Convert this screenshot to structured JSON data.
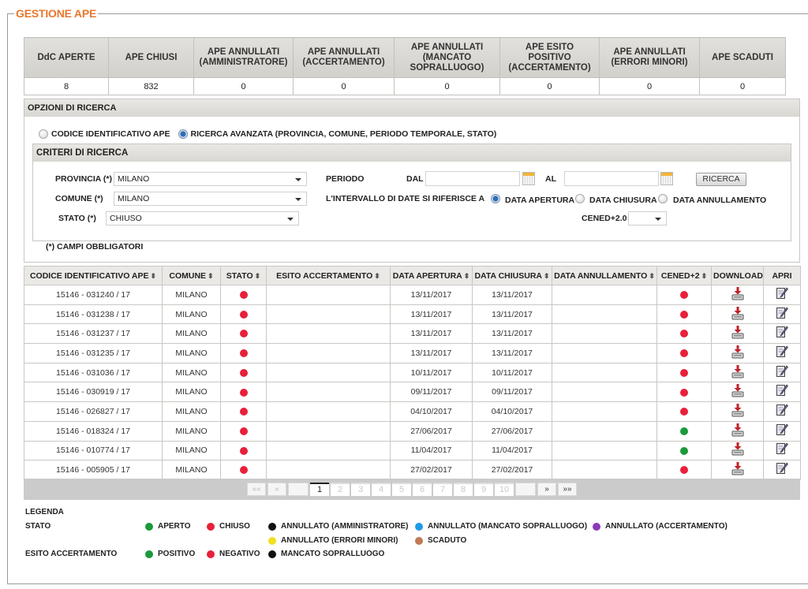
{
  "title": "GESTIONE APE",
  "summary": {
    "headers": [
      "DdC APERTE",
      "APE CHIUSI",
      "APE ANNULLATI (AMMINISTRATORE)",
      "APE ANNULLATI (ACCERTAMENTO)",
      "APE ANNULLATI (MANCATO SOPRALLUOGO)",
      "APE ESITO POSITIVO (ACCERTAMENTO)",
      "APE ANNULLATI (ERRORI MINORI)",
      "APE SCADUTI"
    ],
    "values": [
      "8",
      "832",
      "0",
      "0",
      "0",
      "0",
      "0",
      "0"
    ]
  },
  "search_options": {
    "title": "OPZIONI DI RICERCA",
    "mode_code_label": "CODICE IDENTIFICATIVO APE",
    "mode_advanced_label": "RICERCA AVANZATA (PROVINCIA, COMUNE, PERIODO TEMPORALE, STATO)",
    "selected_mode": "advanced",
    "criteria": {
      "title": "CRITERI DI RICERCA",
      "provincia_label": "PROVINCIA (*)",
      "provincia_value": "MILANO",
      "comune_label": "COMUNE (*)",
      "comune_value": "MILANO",
      "stato_label": "STATO (*)",
      "stato_value": "CHIUSO",
      "periodo_label": "PERIODO",
      "dal_label": "DAL",
      "dal_value": "",
      "al_label": "AL",
      "al_value": "",
      "search_button": "RICERCA",
      "interval_label": "L'INTERVALLO DI DATE SI RIFERISCE A",
      "interval_options": [
        "DATA APERTURA",
        "DATA CHIUSURA",
        "DATA ANNULLAMENTO"
      ],
      "interval_selected": "DATA APERTURA",
      "cened_label": "CENED+2.0",
      "cened_value": ""
    },
    "required_note": "(*) CAMPI OBBLIGATORI"
  },
  "results": {
    "columns": [
      "CODICE IDENTIFICATIVO APE",
      "COMUNE",
      "STATO",
      "ESITO ACCERTAMENTO",
      "DATA APERTURA",
      "DATA CHIUSURA",
      "DATA ANNULLAMENTO",
      "CENED+2",
      "DOWNLOAD",
      "APRI"
    ],
    "rows": [
      {
        "codice": "15146 - 031240 / 17",
        "comune": "MILANO",
        "stato": "CHIUSO",
        "esito": "",
        "apertura": "13/11/2017",
        "chiusura": "13/11/2017",
        "annullamento": "",
        "cened": "red"
      },
      {
        "codice": "15146 - 031238 / 17",
        "comune": "MILANO",
        "stato": "CHIUSO",
        "esito": "",
        "apertura": "13/11/2017",
        "chiusura": "13/11/2017",
        "annullamento": "",
        "cened": "red"
      },
      {
        "codice": "15146 - 031237 / 17",
        "comune": "MILANO",
        "stato": "CHIUSO",
        "esito": "",
        "apertura": "13/11/2017",
        "chiusura": "13/11/2017",
        "annullamento": "",
        "cened": "red"
      },
      {
        "codice": "15146 - 031235 / 17",
        "comune": "MILANO",
        "stato": "CHIUSO",
        "esito": "",
        "apertura": "13/11/2017",
        "chiusura": "13/11/2017",
        "annullamento": "",
        "cened": "red"
      },
      {
        "codice": "15146 - 031036 / 17",
        "comune": "MILANO",
        "stato": "CHIUSO",
        "esito": "",
        "apertura": "10/11/2017",
        "chiusura": "10/11/2017",
        "annullamento": "",
        "cened": "red"
      },
      {
        "codice": "15146 - 030919 / 17",
        "comune": "MILANO",
        "stato": "CHIUSO",
        "esito": "",
        "apertura": "09/11/2017",
        "chiusura": "09/11/2017",
        "annullamento": "",
        "cened": "red"
      },
      {
        "codice": "15146 - 026827 / 17",
        "comune": "MILANO",
        "stato": "CHIUSO",
        "esito": "",
        "apertura": "04/10/2017",
        "chiusura": "04/10/2017",
        "annullamento": "",
        "cened": "red"
      },
      {
        "codice": "15146 - 018324 / 17",
        "comune": "MILANO",
        "stato": "CHIUSO",
        "esito": "",
        "apertura": "27/06/2017",
        "chiusura": "27/06/2017",
        "annullamento": "",
        "cened": "green"
      },
      {
        "codice": "15146 - 010774 / 17",
        "comune": "MILANO",
        "stato": "CHIUSO",
        "esito": "",
        "apertura": "11/04/2017",
        "chiusura": "11/04/2017",
        "annullamento": "",
        "cened": "green"
      },
      {
        "codice": "15146 - 005905 / 17",
        "comune": "MILANO",
        "stato": "CHIUSO",
        "esito": "",
        "apertura": "27/02/2017",
        "chiusura": "27/02/2017",
        "annullamento": "",
        "cened": "red"
      }
    ],
    "icons": {
      "download": "download-icon",
      "open": "edit-document-icon",
      "sort": "sort-icon"
    }
  },
  "pagination": {
    "first": "««",
    "prev": "«",
    "pages": [
      "1",
      "2",
      "3",
      "4",
      "5",
      "6",
      "7",
      "8",
      "9",
      "10"
    ],
    "current": "1",
    "next": "»",
    "last": "»»"
  },
  "legend": {
    "title": "LEGENDA",
    "stato_label": "STATO",
    "stato_items": [
      {
        "label": "APERTO",
        "color": "#1a9a3a"
      },
      {
        "label": "CHIUSO",
        "color": "#e8203a"
      },
      {
        "label": "ANNULLATO (AMMINISTRATORE)",
        "color": "#111111"
      },
      {
        "label": "ANNULLATO (MANCATO SOPRALLUOGO)",
        "color": "#1e9be8"
      },
      {
        "label": "ANNULLATO (ACCERTAMENTO)",
        "color": "#8a3ab8"
      },
      {
        "label": "ANNULLATO (ERRORI MINORI)",
        "color": "#f0e020"
      },
      {
        "label": "SCADUTO",
        "color": "#c07a55"
      }
    ],
    "esito_label": "ESITO ACCERTAMENTO",
    "esito_items": [
      {
        "label": "POSITIVO",
        "color": "#1a9a3a"
      },
      {
        "label": "NEGATIVO",
        "color": "#e8203a"
      },
      {
        "label": "MANCATO SOPRALLUOGO",
        "color": "#111111"
      }
    ]
  },
  "colors": {
    "accent": "#e8772e",
    "status_red": "#e8203a",
    "status_green": "#1a9a3a"
  }
}
